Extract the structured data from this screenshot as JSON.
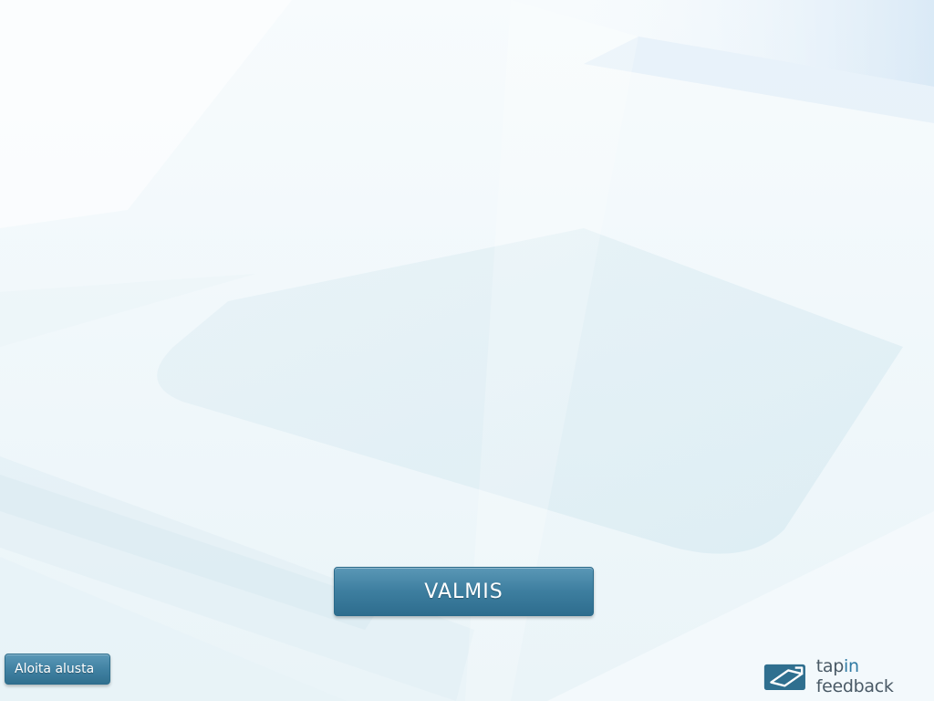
{
  "main": {
    "done_label": "VALMIS"
  },
  "footer": {
    "restart_label": "Aloita alusta",
    "brand": {
      "part1": "tap",
      "part2": "in",
      "part3": " feedback"
    }
  },
  "colors": {
    "button_primary": "#3d7e9f",
    "brand_accent": "#2f7aa3",
    "brand_text": "#4a5a66"
  },
  "icons": {
    "brand_logo": "tapin-feedback-logo-icon"
  }
}
